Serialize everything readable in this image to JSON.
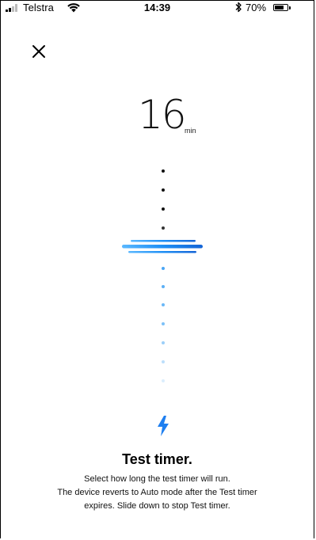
{
  "status_bar": {
    "carrier": "Telstra",
    "time": "14:39",
    "battery_percent": "70%",
    "battery_level": 0.7,
    "icons": [
      "signal-icon",
      "wifi-icon",
      "bluetooth-icon",
      "battery-icon"
    ]
  },
  "header": {
    "close_icon": "close-icon"
  },
  "timer": {
    "value": "16",
    "unit": "min"
  },
  "colors": {
    "accent": "#2a8cf0",
    "accent_light": "#8fc3f8",
    "dark_dot": "#111111",
    "bolt": "#1e7ff0"
  },
  "info": {
    "icon": "lightning-bolt-icon",
    "title": "Test timer.",
    "lines": [
      "Select how long the test timer will run.",
      "The device reverts to Auto mode after the Test timer",
      "expires. Slide down to stop Test timer."
    ]
  }
}
